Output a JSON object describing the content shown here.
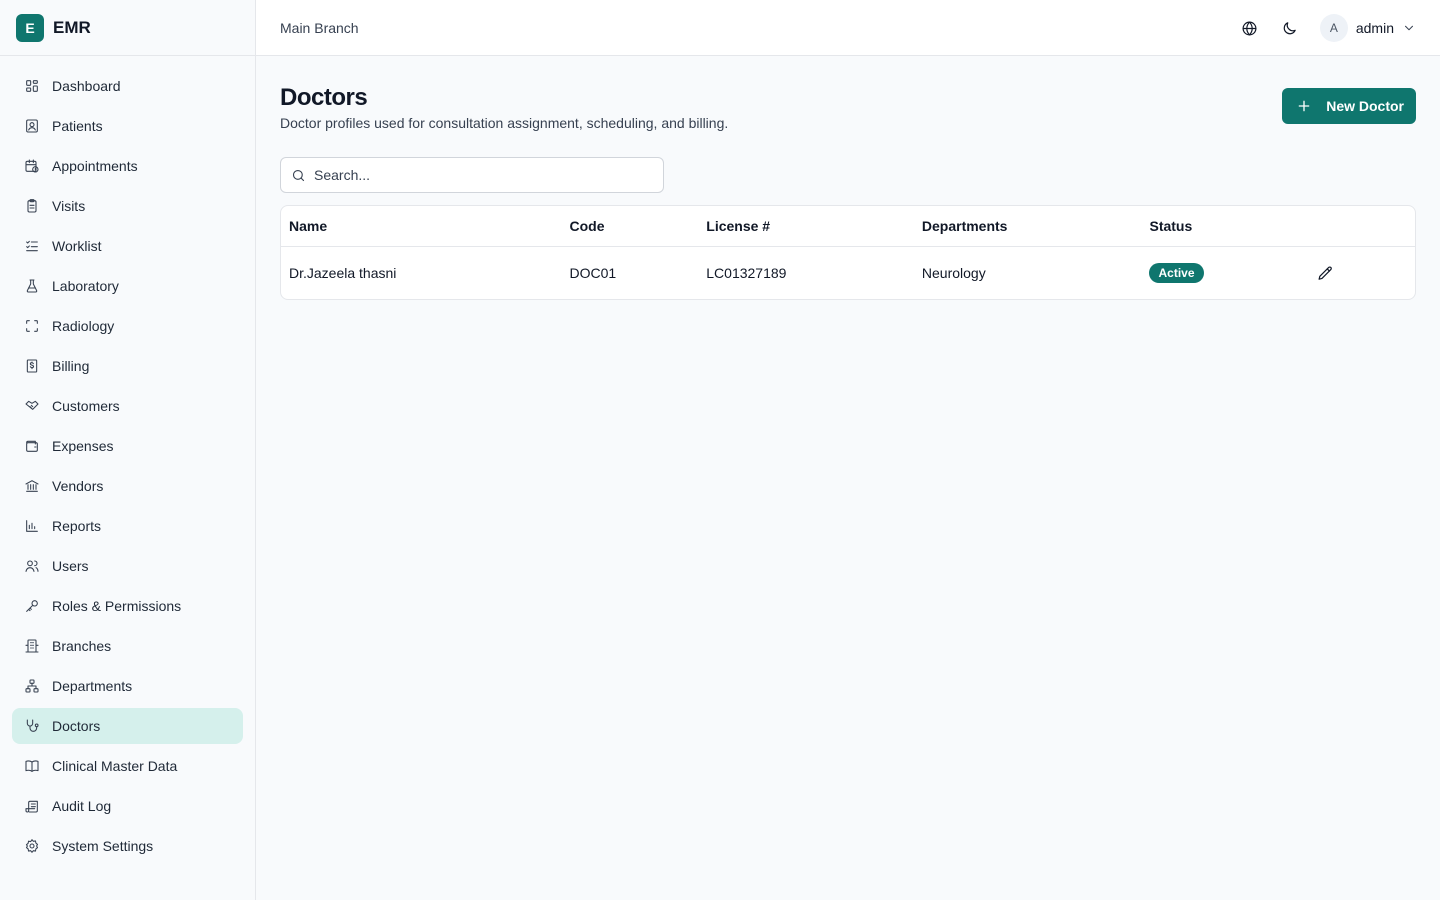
{
  "app": {
    "logo_letter": "E",
    "name": "EMR"
  },
  "sidebar": {
    "items": [
      {
        "label": "Dashboard",
        "icon": "dashboard-icon"
      },
      {
        "label": "Patients",
        "icon": "patient-card-icon"
      },
      {
        "label": "Appointments",
        "icon": "calendar-clock-icon"
      },
      {
        "label": "Visits",
        "icon": "clipboard-icon"
      },
      {
        "label": "Worklist",
        "icon": "list-checks-icon"
      },
      {
        "label": "Laboratory",
        "icon": "flask-icon"
      },
      {
        "label": "Radiology",
        "icon": "scan-icon"
      },
      {
        "label": "Billing",
        "icon": "receipt-icon"
      },
      {
        "label": "Customers",
        "icon": "handshake-icon"
      },
      {
        "label": "Expenses",
        "icon": "wallet-icon"
      },
      {
        "label": "Vendors",
        "icon": "bank-icon"
      },
      {
        "label": "Reports",
        "icon": "bar-chart-icon"
      },
      {
        "label": "Users",
        "icon": "users-icon"
      },
      {
        "label": "Roles & Permissions",
        "icon": "key-icon"
      },
      {
        "label": "Branches",
        "icon": "building-icon"
      },
      {
        "label": "Departments",
        "icon": "network-icon"
      },
      {
        "label": "Doctors",
        "icon": "stethoscope-icon",
        "active": true
      },
      {
        "label": "Clinical Master Data",
        "icon": "book-icon"
      },
      {
        "label": "Audit Log",
        "icon": "scroll-icon"
      },
      {
        "label": "System Settings",
        "icon": "gear-icon"
      }
    ]
  },
  "header": {
    "branch": "Main Branch",
    "user": {
      "initial": "A",
      "name": "admin"
    }
  },
  "page": {
    "title": "Doctors",
    "subtitle": "Doctor profiles used for consultation assignment, scheduling, and billing.",
    "new_button": "New Doctor",
    "search_placeholder": "Search..."
  },
  "table": {
    "columns": [
      "Name",
      "Code",
      "License #",
      "Departments",
      "Status"
    ],
    "rows": [
      {
        "name": "Dr.Jazeela thasni",
        "code": "DOC01",
        "license": "LC01327189",
        "departments": "Neurology",
        "status": "Active"
      }
    ]
  },
  "colors": {
    "accent": "#0f766e",
    "active_nav_bg": "#d5f0ec"
  }
}
